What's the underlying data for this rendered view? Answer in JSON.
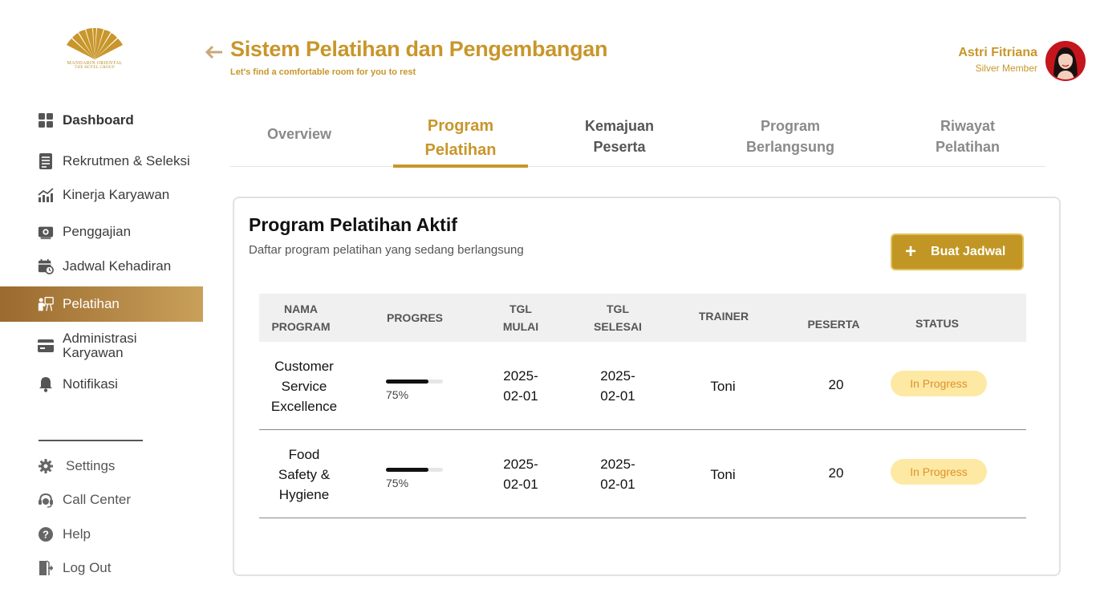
{
  "brand": {
    "line1": "MANDARIN ORIENTAL",
    "line2": "THE HOTEL GROUP",
    "color": "#c8962a"
  },
  "sidebar": {
    "items": [
      {
        "label": "Dashboard",
        "icon": "grid-icon"
      },
      {
        "label": "Rekrutmen & Seleksi",
        "icon": "document-list-icon"
      },
      {
        "label": "Kinerja Karyawan",
        "icon": "chart-up-icon"
      },
      {
        "label": "Penggajian",
        "icon": "payroll-icon"
      },
      {
        "label": "Jadwal Kehadiran",
        "icon": "calendar-clock-icon"
      },
      {
        "label": "Pelatihan",
        "icon": "training-icon",
        "active": true
      },
      {
        "label": "Administrasi Karyawan",
        "icon": "card-icon"
      },
      {
        "label": "Notifikasi",
        "icon": "bell-icon"
      }
    ],
    "bottom_items": [
      {
        "label": "Settings",
        "icon": "gear-icon"
      },
      {
        "label": "Call Center",
        "icon": "headset-icon"
      },
      {
        "label": "Help",
        "icon": "help-icon"
      },
      {
        "label": "Log Out",
        "icon": "logout-icon"
      }
    ],
    "active_gradient": [
      "#9a6a2e",
      "#c9a05a"
    ]
  },
  "header": {
    "title": "Sistem Pelatihan dan Pengembangan",
    "subtitle": "Let's find a comfortable room for you to rest",
    "user_name": "Astri Fitriana",
    "user_level": "Silver Member"
  },
  "tabs": [
    {
      "label": "Overview"
    },
    {
      "label": "Program\nPelatihan",
      "active": true
    },
    {
      "label": "Kemajuan\nPeserta"
    },
    {
      "label": "Program\nBerlangsung"
    },
    {
      "label": "Riwayat\nPelatihan"
    }
  ],
  "card": {
    "title": "Program Pelatihan Aktif",
    "subtitle": "Daftar program pelatihan yang sedang berlangsung",
    "add_button": "Buat Jadwal",
    "add_plus": "+"
  },
  "table": {
    "columns": [
      "NAMA\nPROGRAM",
      "PROGRES",
      "TGL\nMULAI",
      "TGL\nSELESAI",
      "TRAINER",
      "PESERTA",
      "STATUS"
    ],
    "rows": [
      {
        "program": "Customer\nService\nExcellence",
        "progress": 75,
        "progress_text": "75%",
        "start": "2025-\n02-01",
        "end": "2025-\n02-01",
        "trainer": "Toni",
        "participants": "20",
        "status": "In Progress"
      },
      {
        "program": "Food\nSafety &\nHygiene",
        "progress": 75,
        "progress_text": "75%",
        "start": "2025-\n02-01",
        "end": "2025-\n02-01",
        "trainer": "Toni",
        "participants": "20",
        "status": "In Progress"
      }
    ],
    "status_bg": "#fde9a3",
    "status_fg": "#e0902c"
  }
}
